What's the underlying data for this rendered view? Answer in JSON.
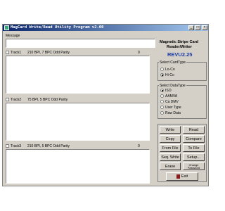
{
  "window": {
    "title": "MagCard Write/Read Utility Program v2.00",
    "minimize": "_",
    "maximize": "□",
    "close": "×"
  },
  "message": {
    "label": "Message",
    "value": ""
  },
  "tracks": [
    {
      "label": "Track1",
      "format": "210 BPI, 7 BPC Odd Parity",
      "count": "0"
    },
    {
      "label": "Track2",
      "format": "75 BPI, 5 BPC Odd Parity",
      "count": "0"
    },
    {
      "label": "Track3",
      "format": "210 BPI, 5 BPC Odd Parity",
      "count": "0"
    }
  ],
  "device": {
    "title_line1": "Magnetic Stripe Card",
    "title_line2": "Reader/Writer",
    "revision": "REVU2.25"
  },
  "card_type": {
    "label": "Select CardType",
    "options": [
      "Lo-Co",
      "Hi-Co"
    ],
    "selected": "Hi-Co"
  },
  "data_type": {
    "label": "Select DataType",
    "options": [
      "ISO",
      "AAMVA",
      "Ca DMV",
      "User Type",
      "Raw Data"
    ],
    "selected": "ISO"
  },
  "buttons": {
    "write": "Write",
    "read": "Read",
    "copy": "Copy",
    "compare": "Compare",
    "from_file": "From File",
    "to_file": "To File",
    "seq_write": "Seq. Write",
    "setup": "Setup...",
    "erase": "Erase",
    "change_password_line1": "Change",
    "change_password_line2": "Password",
    "exit": "Exit"
  }
}
